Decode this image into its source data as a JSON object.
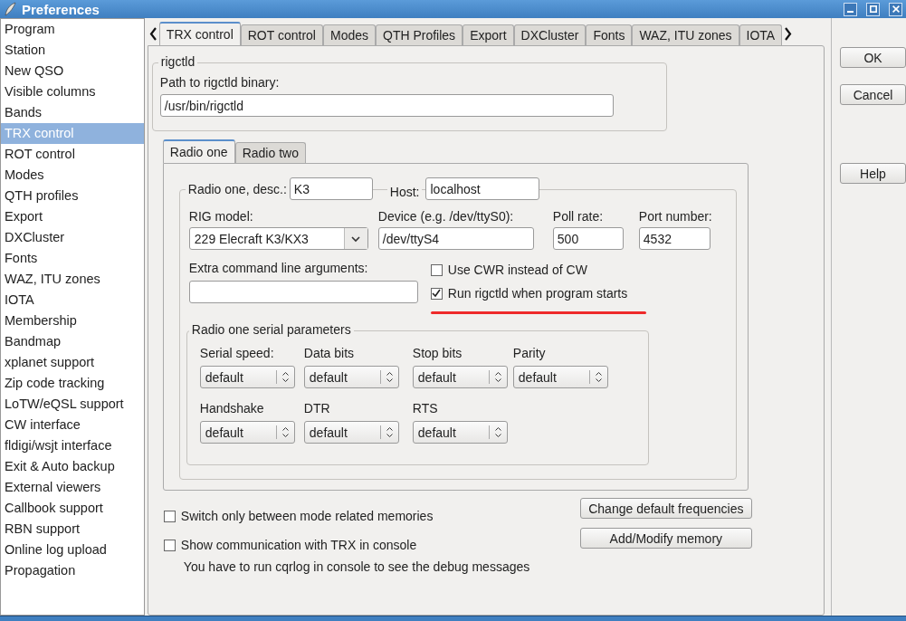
{
  "window": {
    "title": "Preferences"
  },
  "sidebar": {
    "items": [
      {
        "label": "Program",
        "selected": false
      },
      {
        "label": "Station",
        "selected": false
      },
      {
        "label": "New QSO",
        "selected": false
      },
      {
        "label": "Visible columns",
        "selected": false
      },
      {
        "label": "Bands",
        "selected": false
      },
      {
        "label": "TRX control",
        "selected": true
      },
      {
        "label": "ROT control",
        "selected": false
      },
      {
        "label": "Modes",
        "selected": false
      },
      {
        "label": "QTH profiles",
        "selected": false
      },
      {
        "label": "Export",
        "selected": false
      },
      {
        "label": "DXCluster",
        "selected": false
      },
      {
        "label": "Fonts",
        "selected": false
      },
      {
        "label": "WAZ, ITU zones",
        "selected": false
      },
      {
        "label": "IOTA",
        "selected": false
      },
      {
        "label": "Membership",
        "selected": false
      },
      {
        "label": "Bandmap",
        "selected": false
      },
      {
        "label": "xplanet support",
        "selected": false
      },
      {
        "label": "Zip code tracking",
        "selected": false
      },
      {
        "label": "LoTW/eQSL support",
        "selected": false
      },
      {
        "label": "CW interface",
        "selected": false
      },
      {
        "label": "fldigi/wsjt interface",
        "selected": false
      },
      {
        "label": "Exit & Auto backup",
        "selected": false
      },
      {
        "label": "External viewers",
        "selected": false
      },
      {
        "label": "Callbook support",
        "selected": false
      },
      {
        "label": "RBN support",
        "selected": false
      },
      {
        "label": "Online log upload",
        "selected": false
      },
      {
        "label": "Propagation",
        "selected": false
      }
    ]
  },
  "tabs": [
    {
      "label": "TRX control",
      "selected": true
    },
    {
      "label": "ROT control",
      "selected": false
    },
    {
      "label": "Modes",
      "selected": false
    },
    {
      "label": "QTH Profiles",
      "selected": false
    },
    {
      "label": "Export",
      "selected": false
    },
    {
      "label": "DXCluster",
      "selected": false
    },
    {
      "label": "Fonts",
      "selected": false
    },
    {
      "label": "WAZ, ITU zones",
      "selected": false
    },
    {
      "label": "IOTA",
      "selected": false
    }
  ],
  "rigctld": {
    "title": "rigctld",
    "path_label": "Path to rigctld binary:",
    "path": "/usr/bin/rigctld"
  },
  "radio_tabs": [
    {
      "label": "Radio one",
      "selected": true
    },
    {
      "label": "Radio two",
      "selected": false
    }
  ],
  "radio": {
    "desc_label": "Radio one, desc.:",
    "desc": "K3",
    "host_label": "Host:",
    "host": "localhost",
    "rig_model_label": "RIG model:",
    "rig_model": "229 Elecraft K3/KX3",
    "device_label": "Device (e.g. /dev/ttyS0):",
    "device": "/dev/ttyS4",
    "poll_label": "Poll rate:",
    "poll": "500",
    "port_label": "Port number:",
    "port": "4532",
    "extra_label": "Extra command line arguments:",
    "checkboxes": [
      {
        "label": "Use CWR instead of CW",
        "checked": false
      },
      {
        "label": "Run rigctld when program starts",
        "checked": true
      }
    ]
  },
  "serial": {
    "title": "Radio one serial parameters",
    "rows": [
      [
        {
          "label": "Serial speed:",
          "value": "default"
        },
        {
          "label": "Data bits",
          "value": "default"
        },
        {
          "label": "Stop bits",
          "value": "default"
        },
        {
          "label": "Parity",
          "value": "default"
        }
      ],
      [
        {
          "label": "Handshake",
          "value": "default"
        },
        {
          "label": "DTR",
          "value": "default"
        },
        {
          "label": "RTS",
          "value": "default"
        }
      ]
    ]
  },
  "options": [
    {
      "label": "Switch only between mode related memories",
      "checked": false
    },
    {
      "label": "Show communication with TRX in console",
      "checked": false
    }
  ],
  "hint": "You have to run cqrlog in console to see the debug messages",
  "memory_buttons": [
    "Change default frequencies",
    "Add/Modify memory"
  ],
  "dialog_buttons": [
    "OK",
    "Cancel",
    "Help"
  ]
}
